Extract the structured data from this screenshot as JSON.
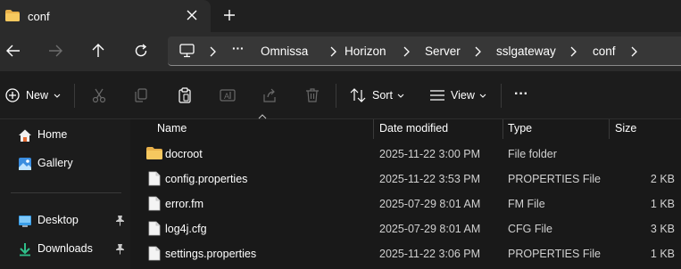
{
  "tab": {
    "title": "conf"
  },
  "address": {
    "more": "···",
    "crumbs": [
      "Omnissa",
      "Horizon",
      "Server",
      "sslgateway",
      "conf"
    ]
  },
  "commands": {
    "new_label": "New",
    "sort_label": "Sort",
    "view_label": "View",
    "more_label": "···"
  },
  "sidebar": {
    "items": [
      {
        "label": "Home"
      },
      {
        "label": "Gallery"
      },
      {
        "label": "Desktop"
      },
      {
        "label": "Downloads"
      }
    ]
  },
  "columns": {
    "name": "Name",
    "date": "Date modified",
    "type": "Type",
    "size": "Size"
  },
  "files": [
    {
      "name": "docroot",
      "date": "2025-11-22 3:00 PM",
      "type": "File folder",
      "size": ""
    },
    {
      "name": "config.properties",
      "date": "2025-11-22 3:53 PM",
      "type": "PROPERTIES File",
      "size": "2 KB"
    },
    {
      "name": "error.fm",
      "date": "2025-07-29 8:01 AM",
      "type": "FM File",
      "size": "1 KB"
    },
    {
      "name": "log4j.cfg",
      "date": "2025-07-29 8:01 AM",
      "type": "CFG File",
      "size": "3 KB"
    },
    {
      "name": "settings.properties",
      "date": "2025-11-22 3:06 PM",
      "type": "PROPERTIES File",
      "size": "1 KB"
    }
  ],
  "colors": {
    "folder": "#e8b04a",
    "accent": "#4cc2ff"
  }
}
